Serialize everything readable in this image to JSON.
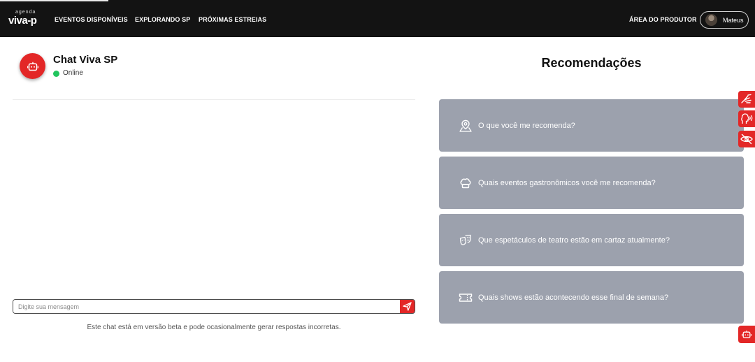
{
  "nav": {
    "logo_small": "agenda",
    "logo_big": "viva-p",
    "links": [
      "EVENTOS DISPONÍVEIS",
      "EXPLORANDO SP",
      "PRÓXIMAS ESTREIAS"
    ],
    "producer_link": "ÁREA DO PRODUTOR",
    "user_name": "Mateus"
  },
  "chat": {
    "title": "Chat Viva SP",
    "status": "Online",
    "input_placeholder": "Digite sua mensagem",
    "disclaimer": "Este chat está em versão beta e pode ocasionalmente gerar respostas incorretas."
  },
  "recommendations": {
    "title": "Recomendações",
    "items": [
      {
        "icon": "map-pin-icon",
        "label": "O que você me recomenda?"
      },
      {
        "icon": "chef-hat-icon",
        "label": "Quais eventos gastronômicos você me recomenda?"
      },
      {
        "icon": "theater-masks-icon",
        "label": "Que espetáculos de teatro estão em cartaz atualmente?"
      },
      {
        "icon": "ticket-icon",
        "label": "Quais shows estão acontecendo esse final de semana?"
      }
    ]
  },
  "accessibility": {
    "buttons": [
      "sign-language-icon",
      "voice-reader-icon",
      "visual-impairment-icon"
    ]
  },
  "colors": {
    "navbar": "#131313",
    "accent": "#e32727",
    "card": "#9ca1ad",
    "online": "#22c55e"
  }
}
